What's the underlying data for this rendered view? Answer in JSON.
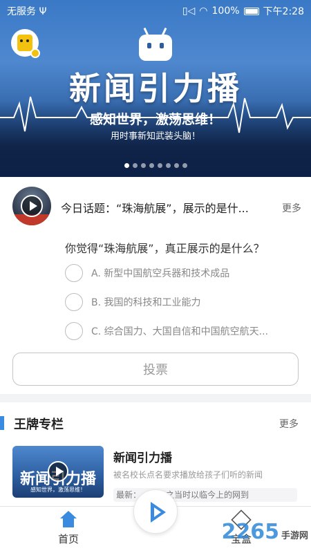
{
  "status_bar": {
    "carrier": "无服务",
    "usb": "Ψ",
    "signal": "▯◁",
    "wifi": "◠",
    "battery": "100%",
    "time": "下午2:28"
  },
  "banner": {
    "title": "新闻引力播",
    "subtitle": "感知世界，激荡思维！",
    "tagline": "用时事新知武装头脑！",
    "slide_count": 8,
    "active_slide": 0
  },
  "topic": {
    "title": "今日话题：“珠海航展”，展示的是什...",
    "more": "更多",
    "question": "你觉得“珠海航展”，真正展示的是什么？",
    "options": [
      "A. 新型中国航空兵器和技术成品",
      "B. 我国的科技和工业能力",
      "C. 综合国力、大国自信和中国航空航天..."
    ],
    "vote_label": "投票"
  },
  "column": {
    "title": "王牌专栏",
    "more": "更多",
    "item": {
      "name": "新闻引力播",
      "description": "被名校长点名要求播放给孩子们听的新闻",
      "tag": "最新：……已之当时以临今上的网到",
      "thumb_title": "新闻引力播",
      "thumb_sub": "感知世界，激荡思维！"
    }
  },
  "nav": {
    "home": "首页",
    "box": "宝盒"
  },
  "watermark": {
    "brand": "2265",
    "text": "手游网"
  }
}
